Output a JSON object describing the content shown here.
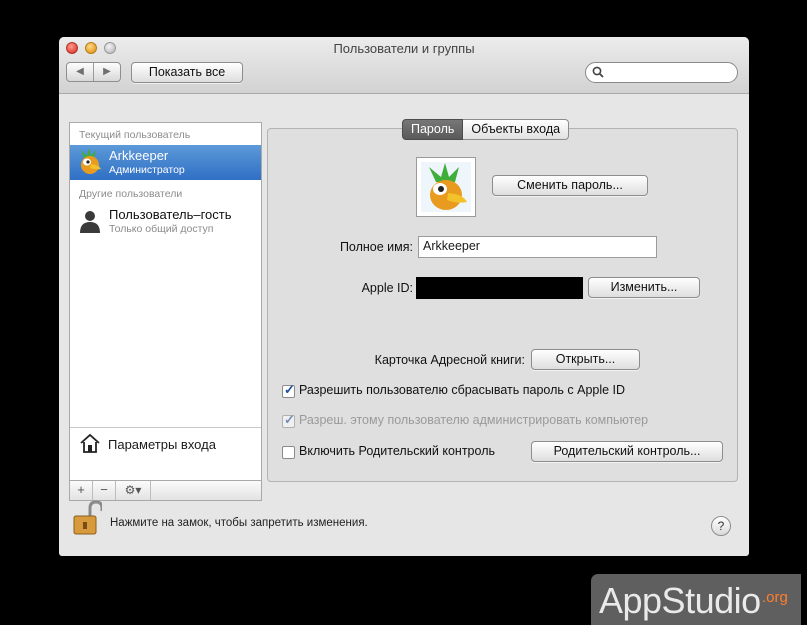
{
  "window": {
    "title": "Пользователи и группы"
  },
  "toolbar": {
    "back": "◀",
    "forward": "▶",
    "show_all": "Показать все",
    "search_placeholder": ""
  },
  "sidebar": {
    "current_user_header": "Текущий пользователь",
    "current_user": {
      "name": "Arkkeeper",
      "role": "Администратор"
    },
    "other_users_header": "Другие пользователи",
    "guest_user": {
      "name": "Пользователь–гость",
      "role": "Только общий доступ"
    },
    "login_options": "Параметры входа",
    "add": "+",
    "remove": "−",
    "gear": "⚙▾"
  },
  "tabs": [
    {
      "label": "Пароль",
      "active": true
    },
    {
      "label": "Объекты входа",
      "active": false
    }
  ],
  "password_pane": {
    "change_password": "Сменить пароль...",
    "full_name_label": "Полное имя:",
    "full_name_value": "Arkkeeper",
    "apple_id_label": "Apple ID:",
    "change_button": "Изменить...",
    "address_card_label": "Карточка Адресной книги:",
    "open_button": "Открыть...",
    "allow_reset": {
      "label": "Разрешить пользователю сбрасывать пароль с Apple ID",
      "checked": true
    },
    "allow_admin": {
      "label": "Разреш. этому пользователю администрировать компьютер",
      "checked": true,
      "enabled": false
    },
    "parental": {
      "label": "Включить Родительский контроль",
      "checked": false
    },
    "parental_button": "Родительский контроль..."
  },
  "footer": {
    "lock_text": "Нажмите на замок, чтобы запретить изменения.",
    "help": "?"
  },
  "watermark": {
    "app": "AppStudio",
    "tld": ".org"
  },
  "colors": {
    "selection": "#3a78c9",
    "watermark_accent": "#ff7e2e"
  }
}
